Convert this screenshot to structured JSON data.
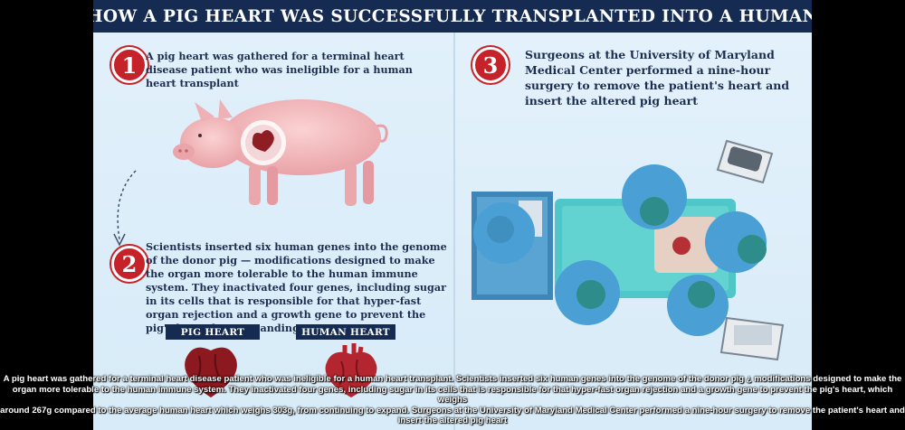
{
  "title": "HOW A PIG HEART WAS SUCCESSFULLY TRANSPLANTED INTO A HUMAN",
  "steps": [
    {
      "number": "1",
      "text": "A pig heart was gathered for a terminal heart disease patient who was ineligible for a human heart transplant"
    },
    {
      "number": "2",
      "text": "Scientists inserted six human genes into the genome of the donor pig — modifications designed to make the organ more tolerable to the human immune system. They inactivated four genes, including sugar in its cells that is responsible for that hyper-fast organ rejection and a growth gene to prevent the pig's heart from expanding"
    },
    {
      "number": "3",
      "text": "Surgeons at the University of Maryland Medical Center performed a nine-hour surgery to remove the patient's heart and insert the altered pig heart"
    }
  ],
  "heart_labels": {
    "pig": "PIG HEART",
    "human": "HUMAN HEART"
  },
  "caption": {
    "line1": "A pig heart was gathered for a terminal heart disease patient who was ineligible for a human heart transplant. Scientists inserted six human genes into the genome of the donor pig ¿ modifications designed to make the",
    "line2": "organ more tolerable to the human immune system. They inactivated four genes, including sugar in its cells that is responsible for that hyper-fast organ rejection and a growth gene to prevent the pig's heart, which weighs",
    "line3": "around 267g compared to the average human heart which weighs 303g, from continuing to expand. Surgeons at the University of Maryland Medical Center performed a nine-hour surgery to remove the patient's heart and",
    "line4": "insert the altered pig heart"
  },
  "colors": {
    "accent_red": "#c62229",
    "navy": "#152b52",
    "background": "#d9ecf9",
    "scrubs": "#4a9fd4"
  }
}
